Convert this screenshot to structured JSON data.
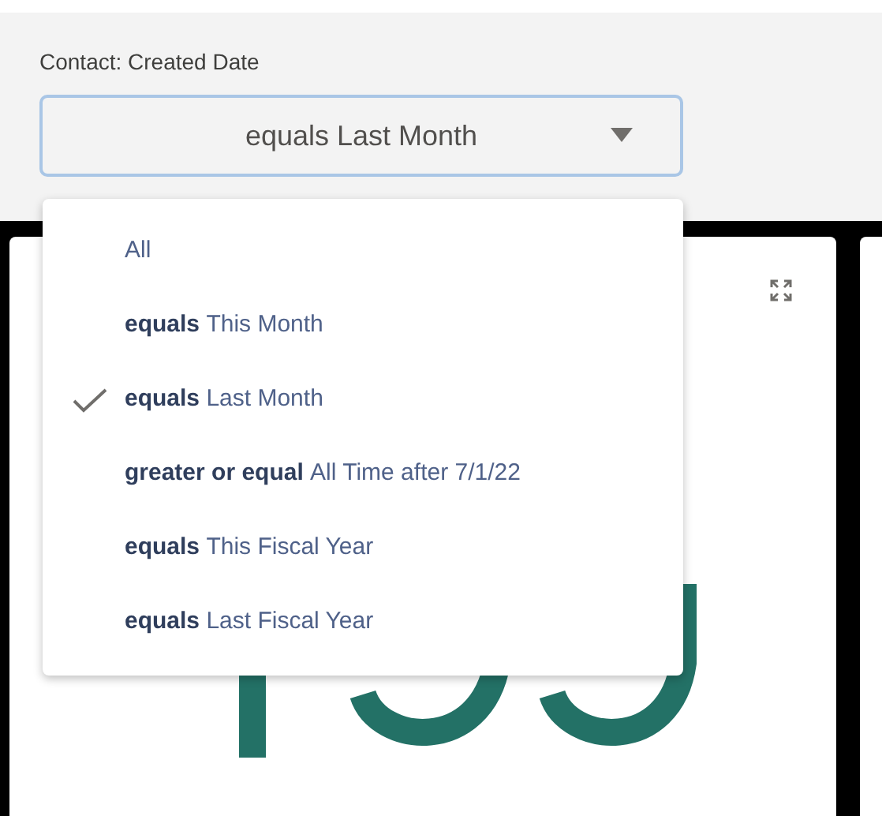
{
  "filter": {
    "label": "Contact: Created Date",
    "value": "equals Last Month"
  },
  "menu": {
    "options": [
      {
        "value": "All",
        "selected": false
      },
      {
        "operator": "equals",
        "value": "This Month",
        "selected": false
      },
      {
        "operator": "equals",
        "value": "Last Month",
        "selected": true
      },
      {
        "operator": "greater or equal",
        "value": "All Time after 7/1/22",
        "selected": false
      },
      {
        "operator": "equals",
        "value": "This Fiscal Year",
        "selected": false
      },
      {
        "operator": "equals",
        "value": "Last Fiscal Year",
        "selected": false
      }
    ]
  }
}
